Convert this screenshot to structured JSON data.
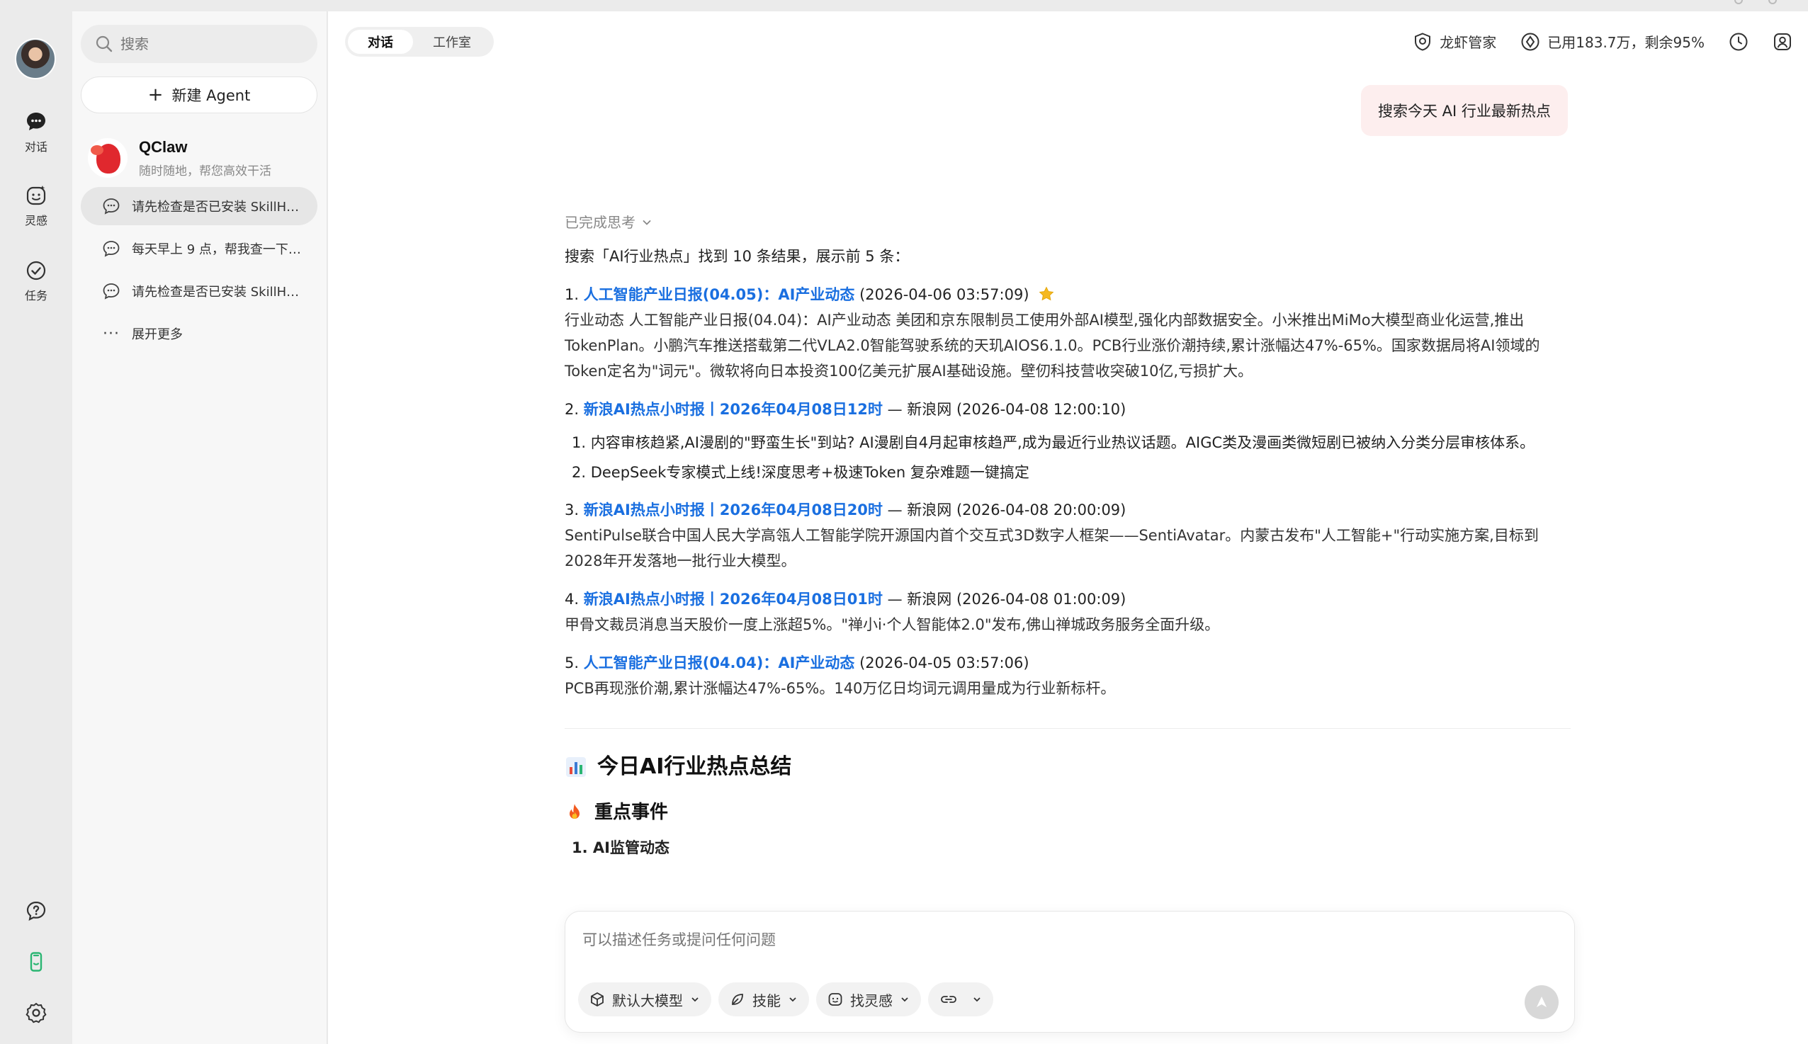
{
  "rail": {
    "items": [
      {
        "label": "对话",
        "icon": "chat-bubble-icon"
      },
      {
        "label": "灵感",
        "icon": "sparkle-face-icon"
      },
      {
        "label": "任务",
        "icon": "task-check-icon"
      }
    ],
    "bottom_icons": [
      "help-icon",
      "phone-icon",
      "settings-icon"
    ]
  },
  "sidebar": {
    "search_placeholder": "搜索",
    "new_agent_label": "新建 Agent",
    "agent": {
      "name": "QClaw",
      "subtitle": "随时随地，帮您高效干活"
    },
    "conversations": [
      {
        "title": "请先检查是否已安装 SkillH…",
        "active": true
      },
      {
        "title": "每天早上 9 点，帮我查一下…",
        "active": false
      },
      {
        "title": "请先检查是否已安装 SkillH…",
        "active": false
      }
    ],
    "expand_label": "展开更多"
  },
  "header": {
    "tabs": [
      {
        "label": "对话",
        "active": true
      },
      {
        "label": "工作室",
        "active": false
      }
    ],
    "butler_label": "龙虾管家",
    "usage_label": "已用183.7万，剩余95%"
  },
  "chat": {
    "user_message": "搜索今天 AI 行业最新热点",
    "thinking_label": "已完成思考",
    "intro": "搜索「AI行业热点」找到 10 条结果，展示前 5 条：",
    "results": [
      {
        "num": "1.",
        "title": "人工智能产业日报(04.05)：AI产业动态",
        "meta": " (2026-04-06 03:57:09)",
        "desc": "行业动态 人工智能产业日报(04.04)：AI产业动态 美团和京东限制员工使用外部AI模型,强化内部数据安全。小米推出MiMo大模型商业化运营,推出TokenPlan。小鹏汽车推送搭载第二代VLA2.0智能驾驶系统的天玑AIOS6.1.0。PCB行业涨价潮持续,累计涨幅达47%-65%。国家数据局将AI领域的Token定名为\"词元\"。微软将向日本投资100亿美元扩展AI基础设施。壁仞科技营收突破10亿,亏损扩大。"
      },
      {
        "num": "2.",
        "title": "新浪AI热点小时报丨2026年04月08日12时",
        "meta": " — 新浪网 (2026-04-08 12:00:10)",
        "sub": [
          "1. 内容审核趋紧,AI漫剧的\"野蛮生长\"到站? AI漫剧自4月起审核趋严,成为最近行业热议话题。AIGC类及漫画类微短剧已被纳入分类分层审核体系。",
          "2. DeepSeek专家模式上线!深度思考+极速Token 复杂难题一键搞定"
        ]
      },
      {
        "num": "3.",
        "title": "新浪AI热点小时报丨2026年04月08日20时",
        "meta": " — 新浪网 (2026-04-08 20:00:09)",
        "desc": "SentiPulse联合中国人民大学高瓴人工智能学院开源国内首个交互式3D数字人框架——SentiAvatar。内蒙古发布\"人工智能+\"行动实施方案,目标到2028年开发落地一批行业大模型。"
      },
      {
        "num": "4.",
        "title": "新浪AI热点小时报丨2026年04月08日01时",
        "meta": " — 新浪网 (2026-04-08 01:00:09)",
        "desc": "甲骨文裁员消息当天股价一度上涨超5%。\"禅小i·个人智能体2.0\"发布,佛山禅城政务服务全面升级。"
      },
      {
        "num": "5.",
        "title": "人工智能产业日报(04.04)：AI产业动态",
        "meta": " (2026-04-05 03:57:06)",
        "desc": "PCB再现涨价潮,累计涨幅达47%-65%。140万亿日均词元调用量成为行业新标杆。"
      }
    ],
    "summary_title": "今日AI行业热点总结",
    "key_events_title": "重点事件",
    "key_event_1": "1. AI监管动态"
  },
  "composer": {
    "placeholder": "可以描述任务或提问任何问题",
    "chips": [
      {
        "label": "默认大模型",
        "icon": "cube-icon"
      },
      {
        "label": "技能",
        "icon": "leaf-icon"
      },
      {
        "label": "找灵感",
        "icon": "smile-icon"
      },
      {
        "label": "",
        "icon": "link-icon"
      }
    ]
  },
  "colors": {
    "link": "#1a6fe0",
    "user_bubble": "#fdeeee",
    "accent_green": "#2bb673"
  }
}
